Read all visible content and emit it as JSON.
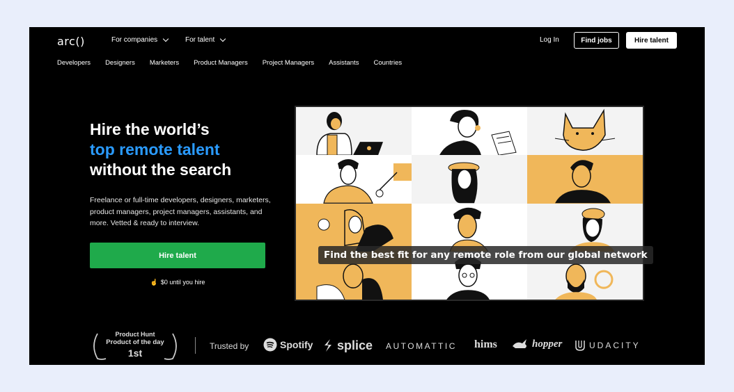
{
  "header": {
    "logo": "arc()",
    "menu": [
      {
        "label": "For companies"
      },
      {
        "label": "For talent"
      }
    ],
    "login": "Log In",
    "find_jobs": "Find jobs",
    "hire_talent": "Hire talent"
  },
  "subnav": [
    "Developers",
    "Designers",
    "Marketers",
    "Product Managers",
    "Project Managers",
    "Assistants",
    "Countries"
  ],
  "hero": {
    "line1": "Hire the world’s",
    "line2": "top remote talent",
    "line3": "without the search",
    "description": "Freelance or full-time developers, designers, marketers, product managers, project managers, assistants, and more. Vetted & ready to interview.",
    "cta": "Hire talent",
    "note": "$0 until you hire"
  },
  "illustration": {
    "caption": "Find the best fit for any remote role from our global network"
  },
  "footer": {
    "award_line1": "Product Hunt",
    "award_line2": "Product of the day",
    "award_line3": "1st",
    "trusted_by": "Trusted by",
    "brands": [
      "Spotify",
      "splice",
      "AUTOMATTIC",
      "hims",
      "hopper",
      "UDACITY"
    ]
  },
  "colors": {
    "accent_blue": "#2a9bff",
    "cta_green": "#1faa4b",
    "illustration_yellow": "#f0b75a",
    "background": "#e9eefb"
  }
}
